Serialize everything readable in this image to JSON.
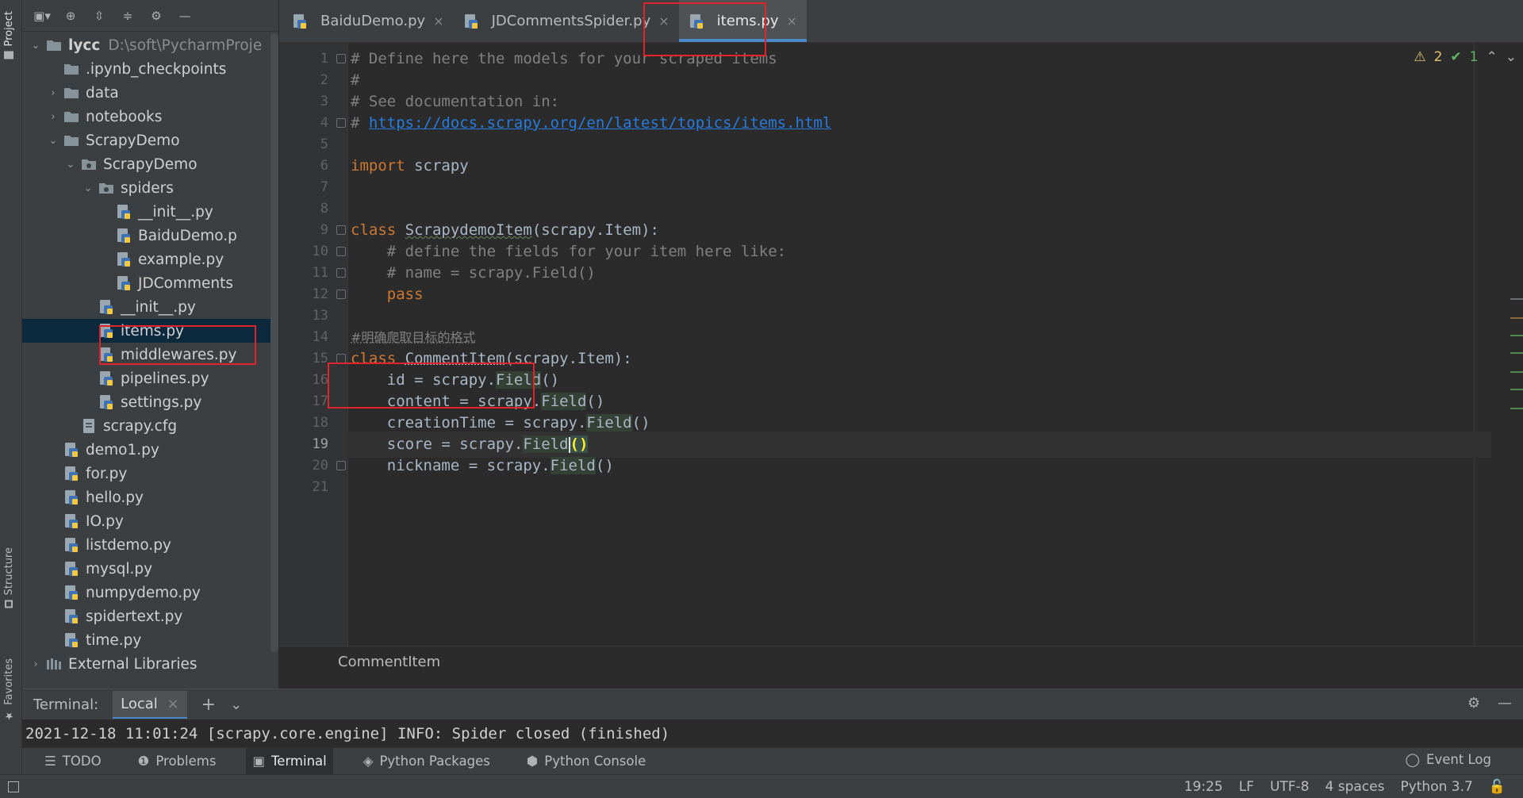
{
  "project": {
    "vertical_tabs": {
      "project": "Project",
      "structure": "Structure",
      "favorites": "Favorites"
    },
    "tree": [
      {
        "label": "lycc",
        "path": "D:\\soft\\PycharmProje",
        "type": "folder",
        "indent": 0,
        "arrow": "down"
      },
      {
        "label": ".ipynb_checkpoints",
        "type": "folder",
        "indent": 1,
        "arrow": "none"
      },
      {
        "label": "data",
        "type": "folder",
        "indent": 1,
        "arrow": "right"
      },
      {
        "label": "notebooks",
        "type": "folder",
        "indent": 1,
        "arrow": "right"
      },
      {
        "label": "ScrapyDemo",
        "type": "folder",
        "indent": 1,
        "arrow": "down"
      },
      {
        "label": "ScrapyDemo",
        "type": "package",
        "indent": 2,
        "arrow": "down"
      },
      {
        "label": "spiders",
        "type": "package",
        "indent": 3,
        "arrow": "down"
      },
      {
        "label": "__init__.py",
        "type": "py",
        "indent": 4,
        "arrow": "none"
      },
      {
        "label": "BaiduDemo.p",
        "type": "py",
        "indent": 4,
        "arrow": "none"
      },
      {
        "label": "example.py",
        "type": "py",
        "indent": 4,
        "arrow": "none"
      },
      {
        "label": "JDComments",
        "type": "py",
        "indent": 4,
        "arrow": "none"
      },
      {
        "label": "__init__.py",
        "type": "py",
        "indent": 3,
        "arrow": "none"
      },
      {
        "label": "items.py",
        "type": "py",
        "indent": 3,
        "arrow": "none",
        "selected": true
      },
      {
        "label": "middlewares.py",
        "type": "py",
        "indent": 3,
        "arrow": "none"
      },
      {
        "label": "pipelines.py",
        "type": "py",
        "indent": 3,
        "arrow": "none"
      },
      {
        "label": "settings.py",
        "type": "py",
        "indent": 3,
        "arrow": "none"
      },
      {
        "label": "scrapy.cfg",
        "type": "cfg",
        "indent": 2,
        "arrow": "none"
      },
      {
        "label": "demo1.py",
        "type": "py",
        "indent": 1,
        "arrow": "none"
      },
      {
        "label": "for.py",
        "type": "py",
        "indent": 1,
        "arrow": "none"
      },
      {
        "label": "hello.py",
        "type": "py",
        "indent": 1,
        "arrow": "none"
      },
      {
        "label": "IO.py",
        "type": "py",
        "indent": 1,
        "arrow": "none"
      },
      {
        "label": "listdemo.py",
        "type": "py",
        "indent": 1,
        "arrow": "none"
      },
      {
        "label": "mysql.py",
        "type": "py",
        "indent": 1,
        "arrow": "none"
      },
      {
        "label": "numpydemo.py",
        "type": "py",
        "indent": 1,
        "arrow": "none"
      },
      {
        "label": "spidertext.py",
        "type": "py",
        "indent": 1,
        "arrow": "none"
      },
      {
        "label": "time.py",
        "type": "py",
        "indent": 1,
        "arrow": "none"
      },
      {
        "label": "External Libraries",
        "type": "lib",
        "indent": 0,
        "arrow": "right"
      }
    ]
  },
  "editor": {
    "tabs": [
      {
        "label": "BaiduDemo.py",
        "active": false
      },
      {
        "label": "JDCommentsSpider.py",
        "active": false
      },
      {
        "label": "items.py",
        "active": true
      }
    ],
    "inspections": {
      "warnings": "2",
      "ok": "1"
    },
    "current_line": 19,
    "lines": [
      {
        "n": "1",
        "html_kind": "comment",
        "text": "# Define here the models for your scraped items"
      },
      {
        "n": "2",
        "html_kind": "comment",
        "text": "#"
      },
      {
        "n": "3",
        "html_kind": "comment",
        "text": "# See documentation in:"
      },
      {
        "n": "4",
        "html_kind": "link",
        "prefix": "# ",
        "text": "https://docs.scrapy.org/en/latest/topics/items.html"
      },
      {
        "n": "5",
        "html_kind": "blank",
        "text": ""
      },
      {
        "n": "6",
        "html_kind": "import",
        "kw": "import",
        "text": " scrapy"
      },
      {
        "n": "7",
        "html_kind": "blank",
        "text": ""
      },
      {
        "n": "8",
        "html_kind": "blank",
        "text": ""
      },
      {
        "n": "9",
        "html_kind": "class",
        "kw": "class",
        "name": "ScrapydemoItem",
        "rest": "(scrapy.Item):"
      },
      {
        "n": "10",
        "html_kind": "comment",
        "text": "    # define the fields for your item here like:"
      },
      {
        "n": "11",
        "html_kind": "comment",
        "text": "    # name = scrapy.Field()"
      },
      {
        "n": "12",
        "html_kind": "pass",
        "kw": "    pass"
      },
      {
        "n": "13",
        "html_kind": "blank",
        "text": ""
      },
      {
        "n": "14",
        "html_kind": "chinese",
        "text": "#明确爬取目标的格式"
      },
      {
        "n": "15",
        "html_kind": "class",
        "kw": "class",
        "name": "CommentItem",
        "rest": "(scrapy.Item):"
      },
      {
        "n": "16",
        "html_kind": "field",
        "lhs": "    id = scrapy.",
        "fn": "Field",
        "tail": "()"
      },
      {
        "n": "17",
        "html_kind": "field",
        "lhs": "    content = scrapy.",
        "fn": "Field",
        "tail": "()"
      },
      {
        "n": "18",
        "html_kind": "field",
        "lhs": "    creationTime = scrapy.",
        "fn": "Field",
        "tail": "()"
      },
      {
        "n": "19",
        "html_kind": "fieldcur",
        "lhs": "    score = scrapy.",
        "fn": "Field",
        "tail": "()"
      },
      {
        "n": "20",
        "html_kind": "field",
        "lhs": "    nickname = scrapy.",
        "fn": "Field",
        "tail": "()"
      },
      {
        "n": "21",
        "html_kind": "blank",
        "text": ""
      }
    ],
    "breadcrumb": "CommentItem"
  },
  "terminal": {
    "title": "Terminal:",
    "tab": "Local",
    "output": "2021-12-18 11:01:24 [scrapy.core.engine] INFO: Spider closed (finished)"
  },
  "tool_windows": [
    {
      "label": "TODO",
      "icon": "list-icon"
    },
    {
      "label": "Problems",
      "icon": "info-icon"
    },
    {
      "label": "Terminal",
      "icon": "terminal-icon",
      "active": true
    },
    {
      "label": "Python Packages",
      "icon": "layers-icon"
    },
    {
      "label": "Python Console",
      "icon": "python-icon"
    }
  ],
  "event_log": "Event Log",
  "status": {
    "position": "19:25",
    "line_sep": "LF",
    "encoding": "UTF-8",
    "indent": "4 spaces",
    "interpreter": "Python 3.7"
  },
  "colors": {
    "highlight_box": "#e0242c",
    "accent": "#4a88c7"
  }
}
